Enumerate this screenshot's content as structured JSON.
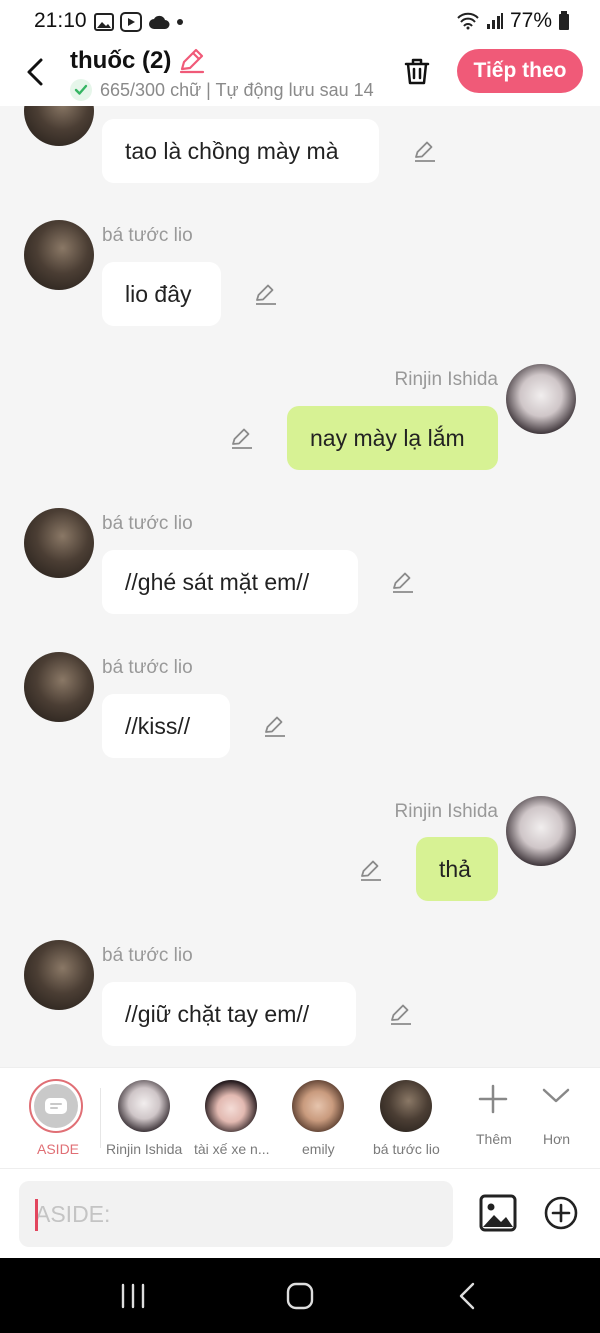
{
  "status_bar": {
    "time": "21:10",
    "battery": "77%"
  },
  "header": {
    "title": "thuốc (2)",
    "subtitle": "665/300 chữ | Tự động lưu sau 14",
    "next_button": "Tiếp theo"
  },
  "chat": {
    "messages": [
      {
        "sender": "bá tước lio",
        "text": "tao là chồng mày mà",
        "side": "left"
      },
      {
        "sender": "bá tước lio",
        "text": "lio đây",
        "side": "left"
      },
      {
        "sender": "Rinjin Ishida",
        "text": "nay mày lạ lắm",
        "side": "right"
      },
      {
        "sender": "bá tước lio",
        "text": "//ghé sát mặt em//",
        "side": "left"
      },
      {
        "sender": "bá tước lio",
        "text": "//kiss//",
        "side": "left"
      },
      {
        "sender": "Rinjin Ishida",
        "text": "thả",
        "side": "right"
      },
      {
        "sender": "bá tước lio",
        "text": "//giữ chặt tay em//",
        "side": "left"
      }
    ]
  },
  "characters": {
    "aside": "ASIDE",
    "items": [
      "Rinjin Ishida",
      "tài xế xe n...",
      "emily",
      "bá tước lio"
    ],
    "more": "Thêm",
    "collapse": "Hơn"
  },
  "input": {
    "placeholder": "ASIDE:"
  },
  "colors": {
    "accent": "#f05a78",
    "my_bubble": "#d7f294",
    "bg": "#f5f5f5"
  }
}
